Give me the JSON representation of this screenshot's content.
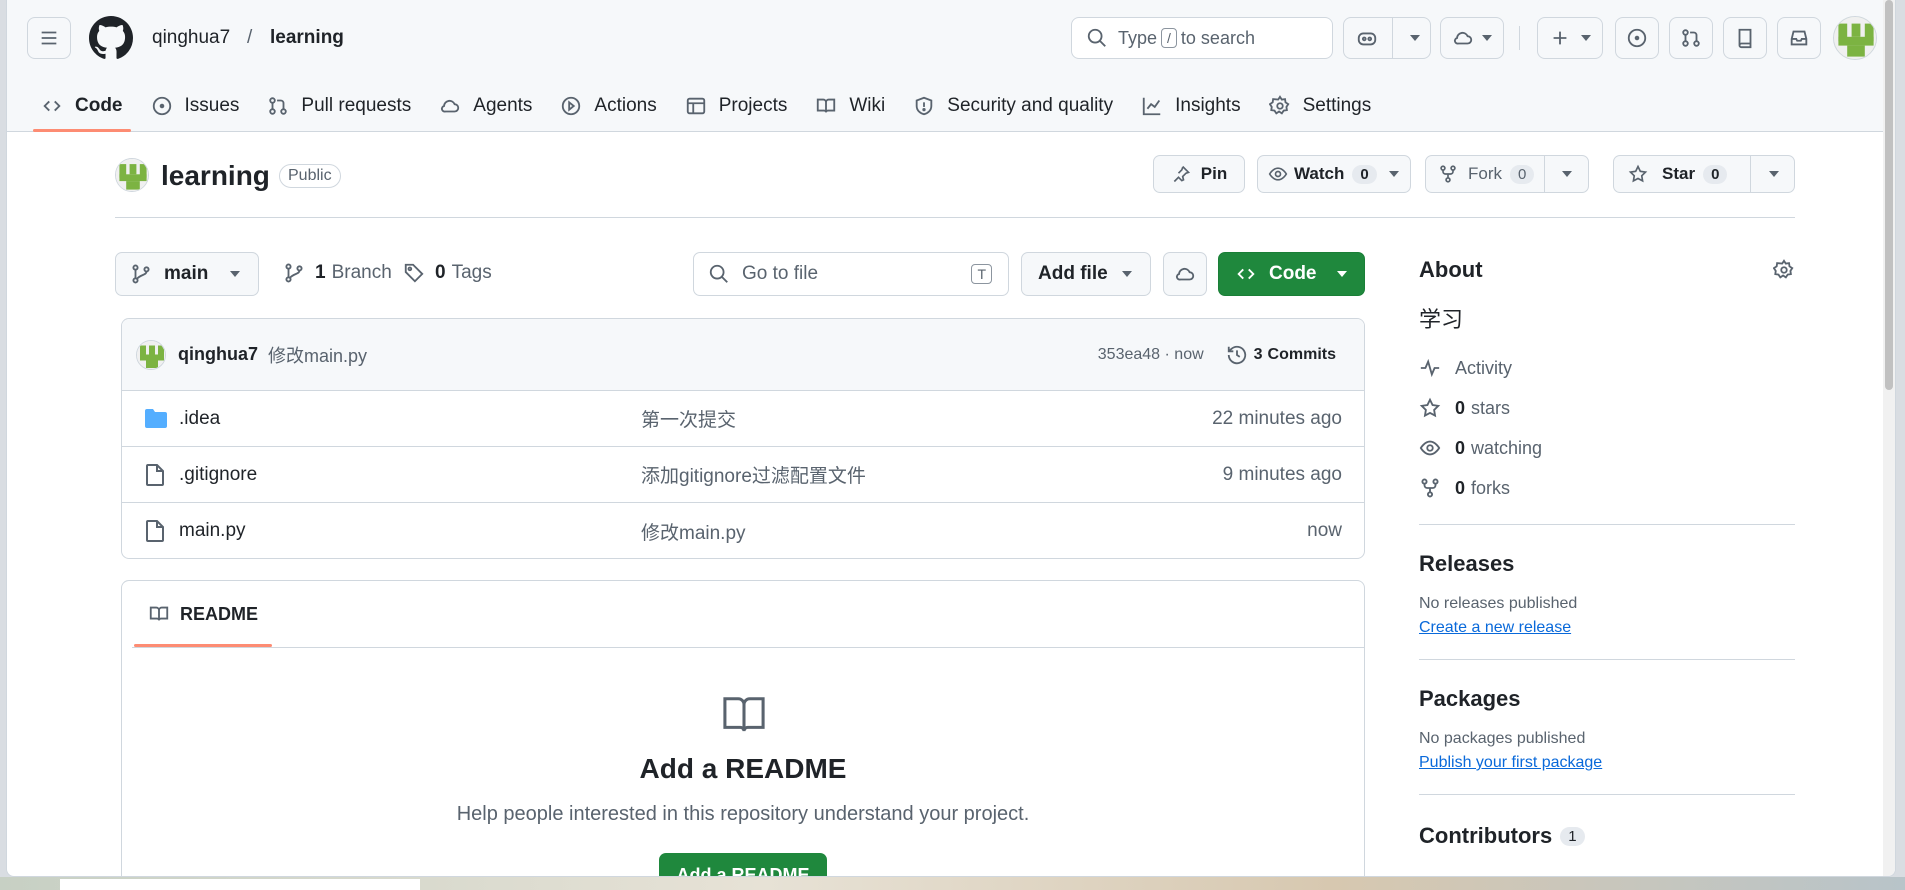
{
  "header": {
    "owner": "qinghua7",
    "separator": "/",
    "repo": "learning",
    "search_pre": "Type",
    "search_key": "/",
    "search_post": "to search"
  },
  "tabs": [
    {
      "label": "Code",
      "icon": "code-icon"
    },
    {
      "label": "Issues",
      "icon": "issue-icon"
    },
    {
      "label": "Pull requests",
      "icon": "pull-request-icon"
    },
    {
      "label": "Agents",
      "icon": "agent-icon"
    },
    {
      "label": "Actions",
      "icon": "play-icon"
    },
    {
      "label": "Projects",
      "icon": "table-icon"
    },
    {
      "label": "Wiki",
      "icon": "book-icon"
    },
    {
      "label": "Security and quality",
      "icon": "shield-icon"
    },
    {
      "label": "Insights",
      "icon": "graph-icon"
    },
    {
      "label": "Settings",
      "icon": "gear-icon"
    }
  ],
  "repo": {
    "name": "learning",
    "visibility": "Public",
    "pin": "Pin",
    "watch": "Watch",
    "watch_count": "0",
    "fork": "Fork",
    "fork_count": "0",
    "star": "Star",
    "star_count": "0"
  },
  "filenav": {
    "branch": "main",
    "branches_n": "1",
    "branches_label": "Branch",
    "tags_n": "0",
    "tags_label": "Tags",
    "goto_placeholder": "Go to file",
    "goto_key": "T",
    "add_file": "Add file",
    "code": "Code"
  },
  "commit": {
    "author": "qinghua7",
    "message": "修改main.py",
    "hash_time": "353ea48 · now",
    "commits_n": "3",
    "commits_label": "Commits"
  },
  "files": [
    {
      "name": ".idea",
      "type": "folder",
      "message": "第一次提交",
      "time": "22 minutes ago"
    },
    {
      "name": ".gitignore",
      "type": "file",
      "message": "添加gitignore过滤配置文件",
      "time": "9 minutes ago"
    },
    {
      "name": "main.py",
      "type": "file",
      "message": "修改main.py",
      "time": "now"
    }
  ],
  "readme": {
    "tab": "README",
    "title": "Add a README",
    "desc": "Help people interested in this repository understand your project.",
    "button": "Add a README"
  },
  "sidebar": {
    "about": "About",
    "description": "学习",
    "activity": "Activity",
    "stars_n": "0",
    "stars": "stars",
    "watching_n": "0",
    "watching": "watching",
    "forks_n": "0",
    "forks": "forks",
    "releases": "Releases",
    "no_releases": "No releases published",
    "create_release": "Create a new release",
    "packages": "Packages",
    "no_packages": "No packages published",
    "publish_package": "Publish your first package",
    "contributors": "Contributors",
    "contributors_n": "1"
  },
  "colors": {
    "accent": "#fd8c73",
    "primary_btn": "#1f883d",
    "link": "#0969da"
  }
}
